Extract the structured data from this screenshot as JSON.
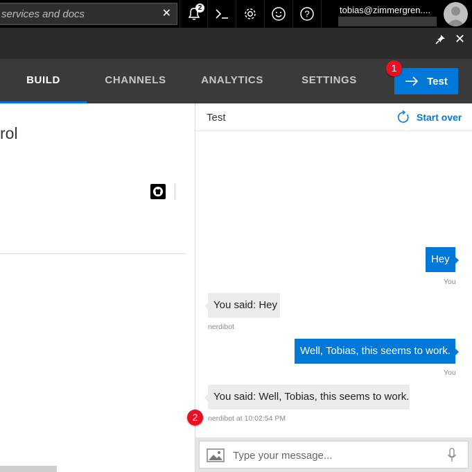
{
  "topbar": {
    "search_placeholder": "services and docs",
    "notification_count": "2",
    "user_email": "tobias@zimmergren...."
  },
  "nav": {
    "tabs": [
      {
        "label": "BUILD",
        "active": true
      },
      {
        "label": "CHANNELS",
        "active": false
      },
      {
        "label": "ANALYTICS",
        "active": false
      },
      {
        "label": "SETTINGS",
        "active": false
      }
    ],
    "test_button": "Test"
  },
  "callouts": [
    "1",
    "2"
  ],
  "left_pane": {
    "title_fragment": "rol"
  },
  "chat": {
    "title": "Test",
    "start_over": "Start over",
    "messages": [
      {
        "from": "user",
        "text": "Hey",
        "meta": "You"
      },
      {
        "from": "bot",
        "text": "You said: Hey",
        "meta": "nerdibot"
      },
      {
        "from": "user",
        "text": "Well, Tobias, this seems to work.",
        "meta": "You"
      },
      {
        "from": "bot",
        "text": "You said: Well, Tobias, this seems to work.",
        "meta": "nerdibot at 10:02:54 PM"
      }
    ],
    "input_placeholder": "Type your message..."
  },
  "colors": {
    "accent": "#0078d7",
    "callout": "#e81123",
    "topbar": "#000000",
    "nav": "#3a3a3a"
  }
}
